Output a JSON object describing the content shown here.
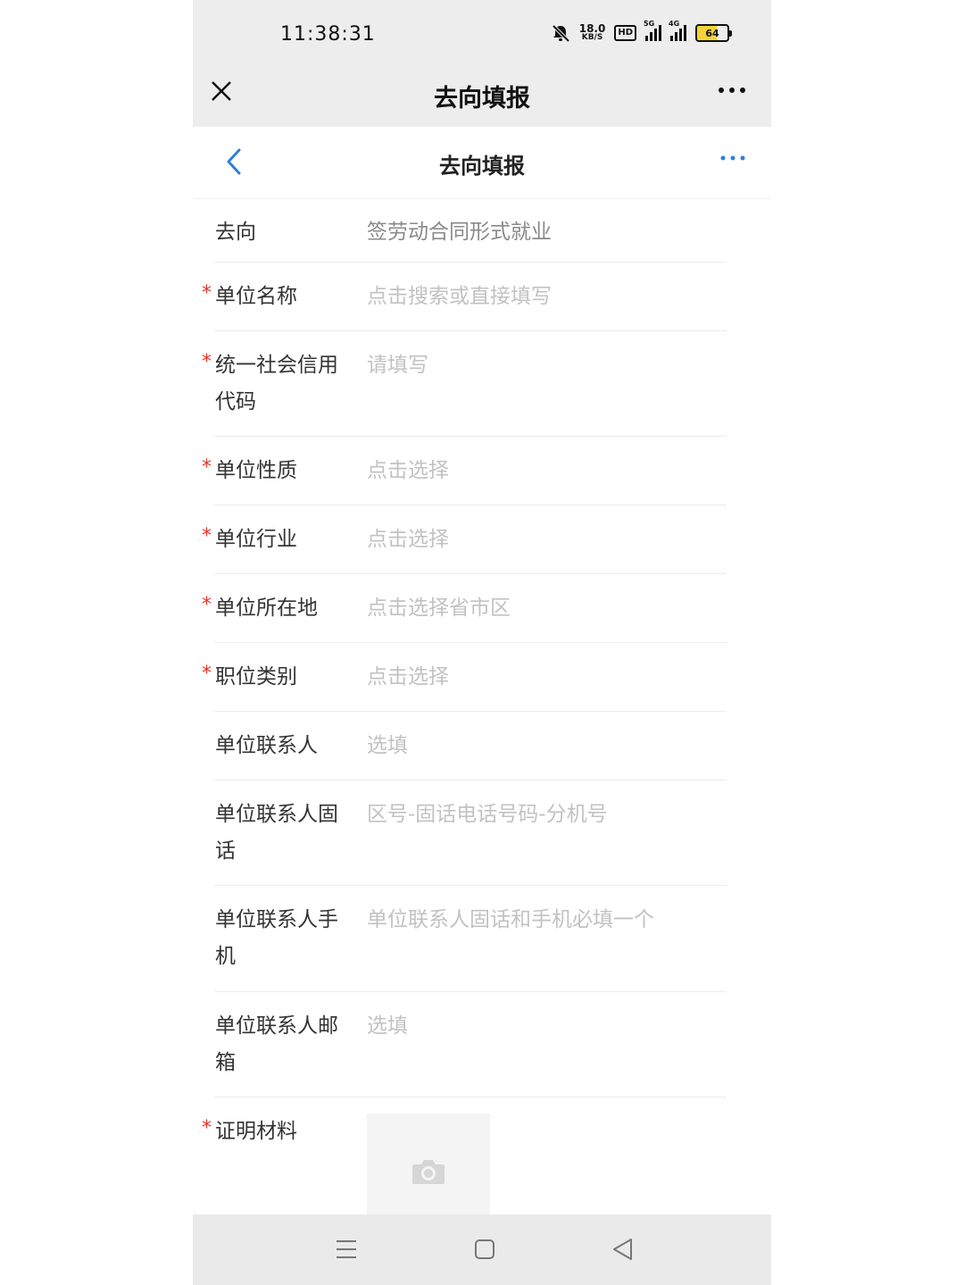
{
  "status_bar": {
    "time": "11:38:31",
    "net_speed": "18.0",
    "net_unit": "KB/S",
    "hd": "HD",
    "sim1_tag": "5G",
    "sim2_tag": "4G",
    "battery_level": 64,
    "battery_text": "64"
  },
  "wx_header": {
    "close_icon": "close-icon",
    "title": "去向填报",
    "more_icon": "more-icon"
  },
  "page_header": {
    "back_icon": "chevron-left-icon",
    "title": "去向填报",
    "more_icon": "more-icon",
    "accent": "#2f7fd6"
  },
  "form": {
    "required_color": "#e5342c",
    "rows": [
      {
        "label": "去向",
        "value": "签劳动合同形式就业",
        "required": false
      },
      {
        "label": "单位名称",
        "value": "点击搜索或直接填写",
        "required": true
      },
      {
        "label": "统一社会信用代码",
        "value": "请填写",
        "required": true
      },
      {
        "label": "单位性质",
        "value": "点击选择",
        "required": true
      },
      {
        "label": "单位行业",
        "value": "点击选择",
        "required": true
      },
      {
        "label": "单位所在地",
        "value": "点击选择省市区",
        "required": true
      },
      {
        "label": "职位类别",
        "value": "点击选择",
        "required": true
      },
      {
        "label": "单位联系人",
        "value": "选填",
        "required": false
      },
      {
        "label": "单位联系人固话",
        "value": "区号-固话电话号码-分机号",
        "required": false
      },
      {
        "label": "单位联系人手机",
        "value": "单位联系人固话和手机必填一个",
        "required": false
      },
      {
        "label": "单位联系人邮箱",
        "value": "选填",
        "required": false
      },
      {
        "label": "证明材料",
        "required": true,
        "upload_icon": "camera-icon"
      }
    ]
  },
  "nav_bar": {
    "menu_icon": "menu-icon",
    "home_icon": "home-square-icon",
    "back_icon": "back-triangle-icon"
  }
}
